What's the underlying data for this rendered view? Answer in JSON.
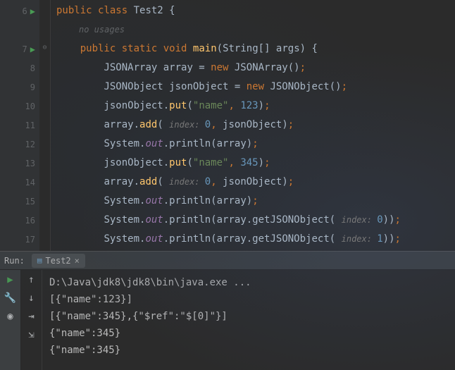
{
  "editor": {
    "hint_text": "no usages",
    "lines": [
      {
        "num": 6,
        "run": true,
        "fold": "",
        "tokens": [
          {
            "t": "public ",
            "c": "kw"
          },
          {
            "t": "class ",
            "c": "kw"
          },
          {
            "t": "Test2 ",
            "c": "type"
          },
          {
            "t": "{",
            "c": "brace"
          }
        ]
      },
      {
        "num": 7,
        "run": true,
        "fold": "⊖",
        "indent": 1,
        "tokens": [
          {
            "t": "public ",
            "c": "kw"
          },
          {
            "t": "static ",
            "c": "kw"
          },
          {
            "t": "void ",
            "c": "kw"
          },
          {
            "t": "main",
            "c": "method"
          },
          {
            "t": "(",
            "c": ""
          },
          {
            "t": "String[] args",
            "c": "type"
          },
          {
            "t": ") {",
            "c": ""
          }
        ]
      },
      {
        "num": 8,
        "indent": 2,
        "tokens": [
          {
            "t": "JSONArray array = ",
            "c": ""
          },
          {
            "t": "new ",
            "c": "kw"
          },
          {
            "t": "JSONArray()",
            "c": ""
          },
          {
            "t": ";",
            "c": "kw"
          }
        ]
      },
      {
        "num": 9,
        "indent": 2,
        "tokens": [
          {
            "t": "JSONObject jsonObject = ",
            "c": ""
          },
          {
            "t": "new ",
            "c": "kw"
          },
          {
            "t": "JSONObject()",
            "c": ""
          },
          {
            "t": ";",
            "c": "kw"
          }
        ]
      },
      {
        "num": 10,
        "indent": 2,
        "tokens": [
          {
            "t": "jsonObject.",
            "c": ""
          },
          {
            "t": "put",
            "c": "method"
          },
          {
            "t": "(",
            "c": ""
          },
          {
            "t": "\"name\"",
            "c": "str"
          },
          {
            "t": ", ",
            "c": "kw"
          },
          {
            "t": "123",
            "c": "num"
          },
          {
            "t": ")",
            "c": ""
          },
          {
            "t": ";",
            "c": "kw"
          }
        ]
      },
      {
        "num": 11,
        "indent": 2,
        "tokens": [
          {
            "t": "array.",
            "c": ""
          },
          {
            "t": "add",
            "c": "method"
          },
          {
            "t": "( ",
            "c": ""
          },
          {
            "t": "index: ",
            "c": "hint"
          },
          {
            "t": "0",
            "c": "num"
          },
          {
            "t": ", ",
            "c": "kw"
          },
          {
            "t": "jsonObject)",
            "c": ""
          },
          {
            "t": ";",
            "c": "kw"
          }
        ]
      },
      {
        "num": 12,
        "indent": 2,
        "tokens": [
          {
            "t": "System.",
            "c": ""
          },
          {
            "t": "out",
            "c": "purple ital"
          },
          {
            "t": ".println(array)",
            "c": ""
          },
          {
            "t": ";",
            "c": "kw"
          }
        ]
      },
      {
        "num": 13,
        "indent": 2,
        "tokens": [
          {
            "t": "jsonObject.",
            "c": ""
          },
          {
            "t": "put",
            "c": "method"
          },
          {
            "t": "(",
            "c": ""
          },
          {
            "t": "\"name\"",
            "c": "str"
          },
          {
            "t": ", ",
            "c": "kw"
          },
          {
            "t": "345",
            "c": "num"
          },
          {
            "t": ")",
            "c": ""
          },
          {
            "t": ";",
            "c": "kw"
          }
        ]
      },
      {
        "num": 14,
        "indent": 2,
        "tokens": [
          {
            "t": "array.",
            "c": ""
          },
          {
            "t": "add",
            "c": "method"
          },
          {
            "t": "( ",
            "c": ""
          },
          {
            "t": "index: ",
            "c": "hint"
          },
          {
            "t": "0",
            "c": "num"
          },
          {
            "t": ", ",
            "c": "kw"
          },
          {
            "t": "jsonObject)",
            "c": ""
          },
          {
            "t": ";",
            "c": "kw"
          }
        ]
      },
      {
        "num": 15,
        "indent": 2,
        "tokens": [
          {
            "t": "System.",
            "c": ""
          },
          {
            "t": "out",
            "c": "purple ital"
          },
          {
            "t": ".println(array)",
            "c": ""
          },
          {
            "t": ";",
            "c": "kw"
          }
        ]
      },
      {
        "num": 16,
        "indent": 2,
        "tokens": [
          {
            "t": "System.",
            "c": ""
          },
          {
            "t": "out",
            "c": "purple ital"
          },
          {
            "t": ".println(array.getJSONObject( ",
            "c": ""
          },
          {
            "t": "index: ",
            "c": "hint"
          },
          {
            "t": "0",
            "c": "num"
          },
          {
            "t": "))",
            "c": ""
          },
          {
            "t": ";",
            "c": "kw"
          }
        ]
      },
      {
        "num": 17,
        "indent": 2,
        "tokens": [
          {
            "t": "System.",
            "c": ""
          },
          {
            "t": "out",
            "c": "purple ital"
          },
          {
            "t": ".println(array.getJSONObject( ",
            "c": ""
          },
          {
            "t": "index: ",
            "c": "hint"
          },
          {
            "t": "1",
            "c": "num"
          },
          {
            "t": "))",
            "c": ""
          },
          {
            "t": ";",
            "c": "kw"
          }
        ]
      }
    ]
  },
  "run": {
    "label": "Run:",
    "tab_name": "Test2",
    "console_lines": [
      "D:\\Java\\jdk8\\jdk8\\bin\\java.exe ...",
      "[{\"name\":123}]",
      "[{\"name\":345},{\"$ref\":\"$[0]\"}]",
      "{\"name\":345}",
      "{\"name\":345}"
    ]
  }
}
